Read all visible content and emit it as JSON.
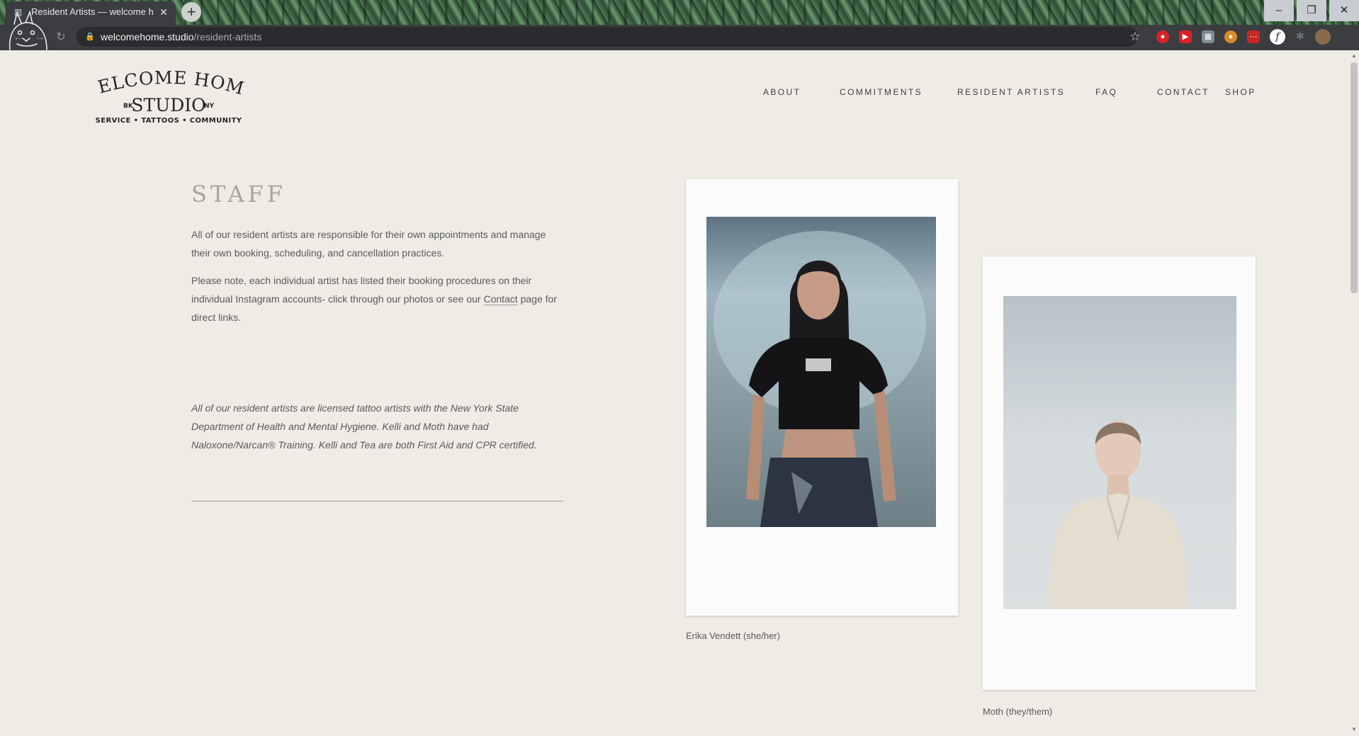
{
  "browser": {
    "tab_title": "Resident Artists — welcome hom",
    "tab_close": "✕",
    "new_tab": "+",
    "url_host": "welcomehome.studio",
    "url_path": "/resident-artists",
    "window_controls": {
      "minimize": "–",
      "restore": "❐",
      "close": "✕"
    }
  },
  "logo": {
    "line1": "WELCOME HOME",
    "left_mark": "BK",
    "line2": "STUDIO",
    "right_mark": "NY",
    "tagline": "SERVICE • TATTOOS • COMMUNITY"
  },
  "nav": {
    "items": [
      "ABOUT",
      "COMMITMENTS",
      "RESIDENT ARTISTS",
      "FAQ",
      "CONTACT",
      "SHOP"
    ]
  },
  "staff": {
    "title": "STAFF",
    "intro": "All of our resident artists are responsible for their own appointments and manage their own booking, scheduling, and cancellation practices.",
    "note_before_link": "Please note, each individual artist has listed their booking procedures on their individual Instagram accounts- click through our photos or see our ",
    "contact_link": "Contact",
    "note_after_link": " page for direct links.",
    "licensing": "All of our resident artists are licensed tattoo artists with the New York State Department of Health and Mental Hygiene. Kelli and Moth have had Naloxone/Narcan® Training. Kelli and Tea are both First Aid and CPR certified."
  },
  "artists": [
    {
      "name": "Erika Vendett (she/her)"
    },
    {
      "name": "Moth (they/them)"
    }
  ]
}
